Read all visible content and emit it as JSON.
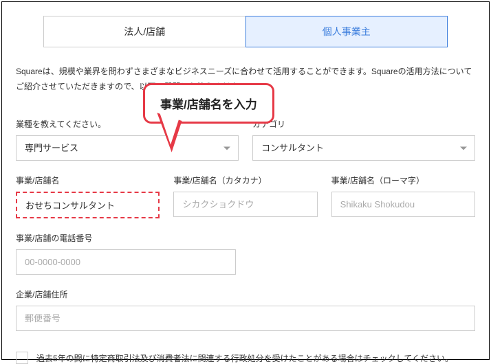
{
  "tabs": {
    "corporate": "法人/店舗",
    "individual": "個人事業主"
  },
  "intro": "Squareは、規模や業界を問わずさまざまなビジネスニーズに合わせて活用することができます。Squareの活用方法についてご紹介させていただきますので、以下の質問にお答えください。",
  "callout": {
    "text": "事業/店舗名を入力"
  },
  "industry": {
    "label": "業種を教えてください。",
    "value": "専門サービス"
  },
  "category": {
    "label": "カテゴリ",
    "value": "コンサルタント"
  },
  "business_name": {
    "label": "事業/店舗名",
    "value": "おせちコンサルタント"
  },
  "business_name_kana": {
    "label": "事業/店舗名（カタカナ）",
    "placeholder": "シカクショクドウ"
  },
  "business_name_roman": {
    "label": "事業/店舗名（ローマ字）",
    "placeholder": "Shikaku Shokudou"
  },
  "phone": {
    "label": "事業/店舗の電話番号",
    "placeholder": "00-0000-0000"
  },
  "address": {
    "label": "企業/店舗住所",
    "placeholder": "郵便番号"
  },
  "checkbox": {
    "label": "過去5年の間に特定商取引法及び消費者法に関連する行政処分を受けたことがある場合はチェックしてください。"
  }
}
